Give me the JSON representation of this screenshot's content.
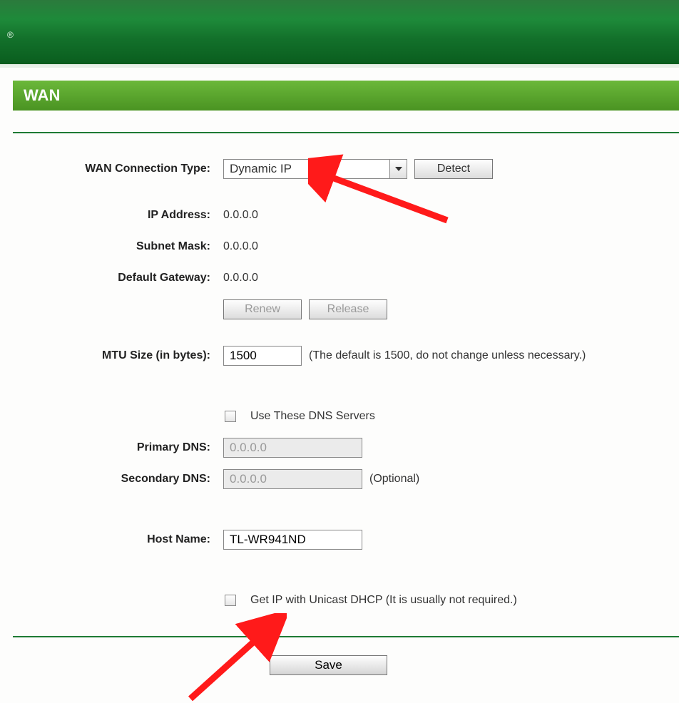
{
  "section": {
    "title": "WAN"
  },
  "fields": {
    "wan_type_label": "WAN Connection Type:",
    "wan_type_value": "Dynamic IP",
    "detect_btn": "Detect",
    "ip_label": "IP Address:",
    "ip_value": "0.0.0.0",
    "mask_label": "Subnet Mask:",
    "mask_value": "0.0.0.0",
    "gw_label": "Default Gateway:",
    "gw_value": "0.0.0.0",
    "renew_btn": "Renew",
    "release_btn": "Release",
    "mtu_label": "MTU Size (in bytes):",
    "mtu_value": "1500",
    "mtu_hint": "(The default is 1500, do not change unless necessary.)",
    "dns_check_label": "Use These DNS Servers",
    "p_dns_label": "Primary DNS:",
    "p_dns_value": "0.0.0.0",
    "s_dns_label": "Secondary DNS:",
    "s_dns_value": "0.0.0.0",
    "s_dns_hint": "(Optional)",
    "host_label": "Host Name:",
    "host_value": "TL-WR941ND",
    "unicast_label": "Get IP with Unicast DHCP (It is usually not required.)",
    "save_btn": "Save"
  }
}
